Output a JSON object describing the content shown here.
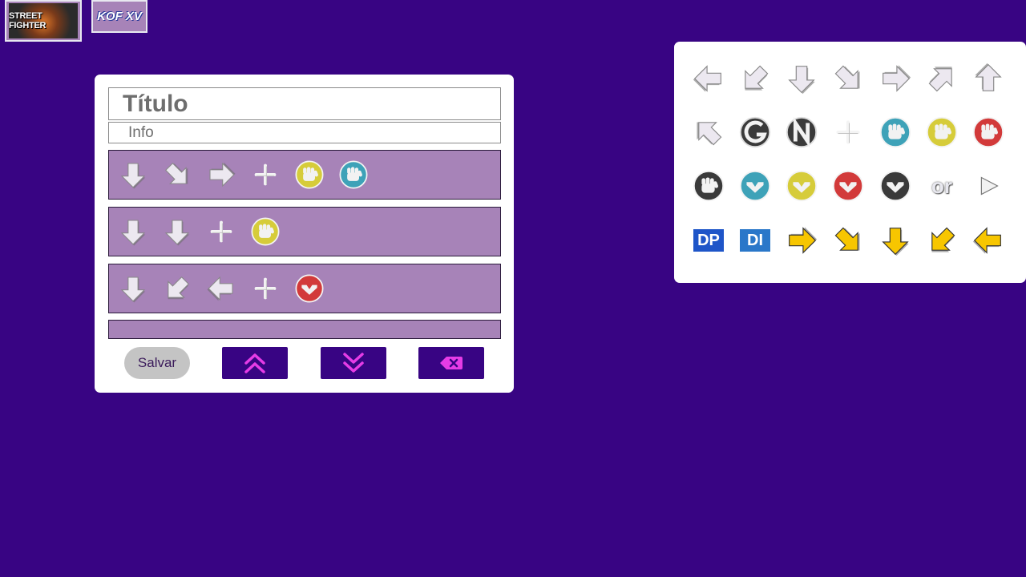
{
  "games": [
    {
      "name": "STREET FIGHTER",
      "selected": true
    },
    {
      "name": "KOF XV",
      "selected": false
    }
  ],
  "editor": {
    "title_placeholder": "Título",
    "info_placeholder": "Info",
    "combos": [
      [
        "arrow-down",
        "arrow-down-right",
        "arrow-right",
        "plus",
        "punch-yellow",
        "punch-blue"
      ],
      [
        "arrow-down",
        "arrow-down",
        "plus",
        "punch-yellow"
      ],
      [
        "arrow-down",
        "arrow-down-left",
        "arrow-left",
        "plus",
        "kick-red"
      ],
      []
    ],
    "save_label": "Salvar"
  },
  "palette": {
    "rows": [
      [
        "arrow-left",
        "arrow-down-left",
        "arrow-down",
        "arrow-down-right",
        "arrow-right",
        "arrow-up-right",
        "arrow-up"
      ],
      [
        "arrow-up-left",
        "icon-g",
        "icon-n",
        "plus",
        "punch-blue",
        "punch-yellow",
        "punch-red"
      ],
      [
        "punch-black",
        "kick-blue",
        "kick-yellow",
        "kick-red",
        "kick-black",
        "or",
        "play"
      ],
      [
        "dp",
        "di",
        "yarrow-right",
        "yarrow-down-right",
        "yarrow-down",
        "yarrow-down-left",
        "yarrow-left"
      ]
    ],
    "or_text": "or",
    "dp_text": "DP",
    "di_text": "DI"
  },
  "colors": {
    "background": "#380483",
    "row": "#a783b8",
    "punch_yellow": "#d6cc3a",
    "punch_blue": "#3ea2b8",
    "punch_red": "#d23a3a",
    "punch_black": "#3a3a3a",
    "yellow_arrow": "#f7c600"
  }
}
